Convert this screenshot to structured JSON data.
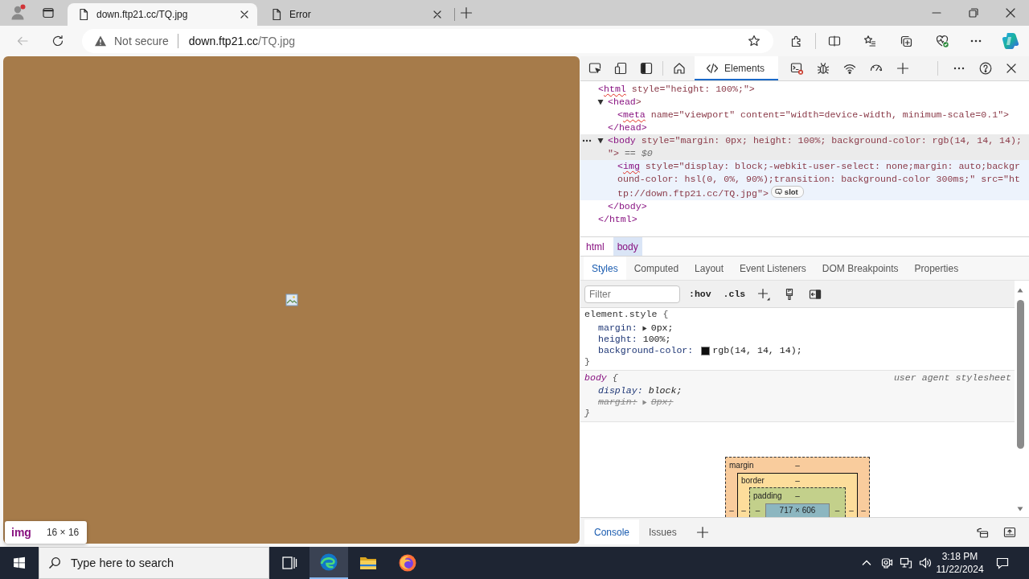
{
  "browser": {
    "tabs": [
      {
        "title": "down.ftp21.cc/TQ.jpg",
        "selected": true
      },
      {
        "title": "Error",
        "selected": false
      }
    ],
    "back_button": {
      "disabled": true
    },
    "address_bar": {
      "security_label": "Not secure",
      "host": "down.ftp21.cc",
      "path": "/TQ.jpg"
    }
  },
  "page": {
    "inspect_tooltip": {
      "tag": "img",
      "size": "16 × 16"
    }
  },
  "devtools": {
    "panel_tabs": [
      {
        "label": "Elements",
        "selected": true
      }
    ],
    "dom_tree": [
      {
        "open": [
          "<",
          "html",
          " style=\"height: 100%;\">"
        ],
        "flagged": true,
        "selected": false,
        "hovered": false,
        "children": [
          {
            "open": [
              "<",
              "head",
              ">"
            ],
            "flagged": false,
            "expanded": true,
            "selected": false,
            "hovered": false,
            "children": [
              {
                "open": [
                  "<",
                  "meta",
                  " name=\"viewport\" content=\"width=device-width, minimum-scale=0.1\">"
                ],
                "flagged": true,
                "selected": false,
                "hovered": false
              }
            ],
            "close": "</head>"
          },
          {
            "open": [
              "<",
              "body",
              " style=\"margin: 0px; height: 100%; background-color: rgb(14, 14, 14);\">"
            ],
            "suffix": "== $0",
            "flagged": false,
            "expanded": true,
            "selected": true,
            "hovered": false,
            "children": [
              {
                "open": [
                  "<",
                  "img",
                  " style=\"display: block;-webkit-user-select: none;margin: auto;background-color: hsl(0, 0%, 90%);transition: background-color 300ms;\" src=\"http://down.ftp21.cc/TQ.jpg\">"
                ],
                "badge": "slot",
                "flagged": true,
                "selected": false,
                "hovered": true
              }
            ],
            "close": "</body>"
          }
        ],
        "close": "</html>"
      }
    ],
    "breadcrumbs": [
      {
        "label": "html",
        "selected": false
      },
      {
        "label": "body",
        "selected": true
      }
    ],
    "sidebar_tabs": [
      {
        "label": "Styles",
        "selected": true
      },
      {
        "label": "Computed",
        "selected": false
      },
      {
        "label": "Layout",
        "selected": false
      },
      {
        "label": "Event Listeners",
        "selected": false
      },
      {
        "label": "DOM Breakpoints",
        "selected": false
      },
      {
        "label": "Properties",
        "selected": false
      }
    ],
    "styles_toolbar": {
      "filter": {
        "placeholder": "Filter"
      },
      "buttons": [
        ":hov",
        ".cls"
      ]
    },
    "rules": [
      {
        "kind": "inline",
        "selector": "element.style",
        "open": "{",
        "close": "}",
        "declarations": [
          {
            "property": "margin:",
            "value": "0px;",
            "expandable": true,
            "overridden": false
          },
          {
            "property": "height:",
            "value": "100%;",
            "expandable": false,
            "overridden": false
          },
          {
            "property": "background-color:",
            "value": "rgb(14, 14, 14);",
            "color": "#0e0e0e",
            "expandable": false,
            "overridden": false
          }
        ]
      },
      {
        "kind": "user_agent",
        "selector": "body",
        "open": "{",
        "close": "}",
        "source": "user agent stylesheet",
        "declarations": [
          {
            "property": "display:",
            "value": "block;",
            "expandable": false,
            "overridden": false
          },
          {
            "property": "margin:",
            "value": "8px;",
            "expandable": true,
            "overridden": true
          }
        ]
      }
    ],
    "box_model": {
      "layers": [
        {
          "label": "margin",
          "top": "–"
        },
        {
          "label": "border",
          "top": "–"
        },
        {
          "label": "padding",
          "top": "–"
        }
      ],
      "left_values": [
        "–",
        "–",
        "–"
      ],
      "content": "717 × 606",
      "right_values": [
        "–",
        "–",
        "–"
      ]
    },
    "drawer_tabs": [
      {
        "label": "Console",
        "selected": true
      },
      {
        "label": "Issues",
        "selected": false
      }
    ]
  },
  "taskbar": {
    "search": {
      "placeholder": "Type here to search"
    },
    "apps": [
      {
        "selected": false
      },
      {
        "selected": true
      },
      {
        "selected": false
      },
      {
        "selected": false
      }
    ],
    "clock": {
      "time": "3:18 PM",
      "date": "11/22/2024"
    }
  }
}
